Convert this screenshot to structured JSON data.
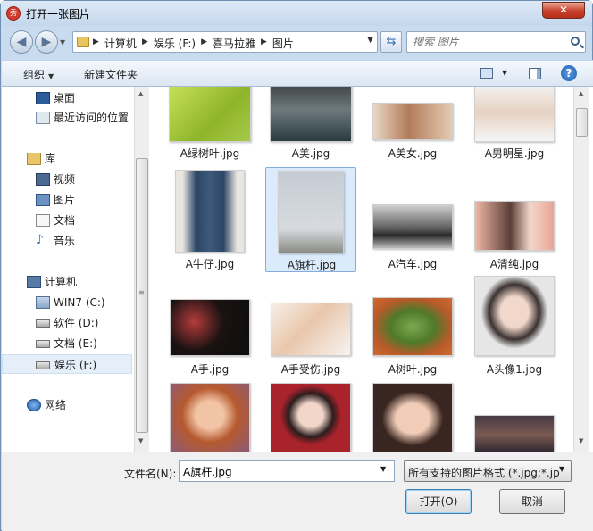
{
  "window": {
    "title": "打开一张图片",
    "app_icon": "秀",
    "close_label": "✕"
  },
  "nav_bar": {
    "back_glyph": "◀",
    "forward_glyph": "▶",
    "breadcrumbs": [
      "计算机",
      "娱乐 (F:)",
      "喜马拉雅",
      "图片"
    ],
    "search_placeholder": "搜索 图片"
  },
  "command_bar": {
    "organize": "组织",
    "new_folder": "新建文件夹",
    "help": "?"
  },
  "sidebar": {
    "items": [
      {
        "label": "桌面",
        "icon": "desktop-icon"
      },
      {
        "label": "最近访问的位置",
        "icon": "recent-places-icon"
      },
      {
        "label": "库",
        "icon": "libraries-icon"
      },
      {
        "label": "视频",
        "icon": "videos-icon"
      },
      {
        "label": "图片",
        "icon": "pictures-icon"
      },
      {
        "label": "文档",
        "icon": "documents-icon"
      },
      {
        "label": "音乐",
        "icon": "music-icon"
      },
      {
        "label": "计算机",
        "icon": "computer-icon"
      },
      {
        "label": "WIN7 (C:)",
        "icon": "drive-c-icon"
      },
      {
        "label": "软件 (D:)",
        "icon": "drive-d-icon"
      },
      {
        "label": "文档 (E:)",
        "icon": "drive-e-icon"
      },
      {
        "label": "娱乐 (F:)",
        "icon": "drive-f-icon",
        "selected": true
      },
      {
        "label": "网络",
        "icon": "network-icon"
      }
    ]
  },
  "files": [
    {
      "name": "A绿树叶.jpg",
      "thumb": "green-leaf-image"
    },
    {
      "name": "A美.jpg",
      "thumb": "woman-scarf-image"
    },
    {
      "name": "A美女.jpg",
      "thumb": "woman-portrait-image"
    },
    {
      "name": "A男明星.jpg",
      "thumb": "male-star-image"
    },
    {
      "name": "A牛仔.jpg",
      "thumb": "jeans-image"
    },
    {
      "name": "A旗杆.jpg",
      "thumb": "flagpole-image",
      "selected": true
    },
    {
      "name": "A汽车.jpg",
      "thumb": "vintage-car-image"
    },
    {
      "name": "A清纯.jpg",
      "thumb": "girl-portrait-image"
    },
    {
      "name": "A手.jpg",
      "thumb": "hand-dark-image"
    },
    {
      "name": "A手受伤.jpg",
      "thumb": "injured-hand-image"
    },
    {
      "name": "A树叶.jpg",
      "thumb": "leaf-image"
    },
    {
      "name": "A头像1.jpg",
      "thumb": "avatar-image"
    },
    {
      "name": "",
      "thumb": "cartoon-girl-image"
    },
    {
      "name": "",
      "thumb": "woman-red-image"
    },
    {
      "name": "",
      "thumb": "smiling-woman-image"
    },
    {
      "name": "",
      "thumb": "sunset-sea-image"
    }
  ],
  "footer": {
    "filename_label": "文件名(N):",
    "filename_value": "A旗杆.jpg",
    "filetype_value": "所有支持的图片格式 (*.jpg;*.jp",
    "open_button": "打开(O)",
    "cancel_button": "取消"
  },
  "colors": {
    "frame": "#c9dcef",
    "selection": "#dcebfc",
    "close_button": "#c7402a"
  }
}
